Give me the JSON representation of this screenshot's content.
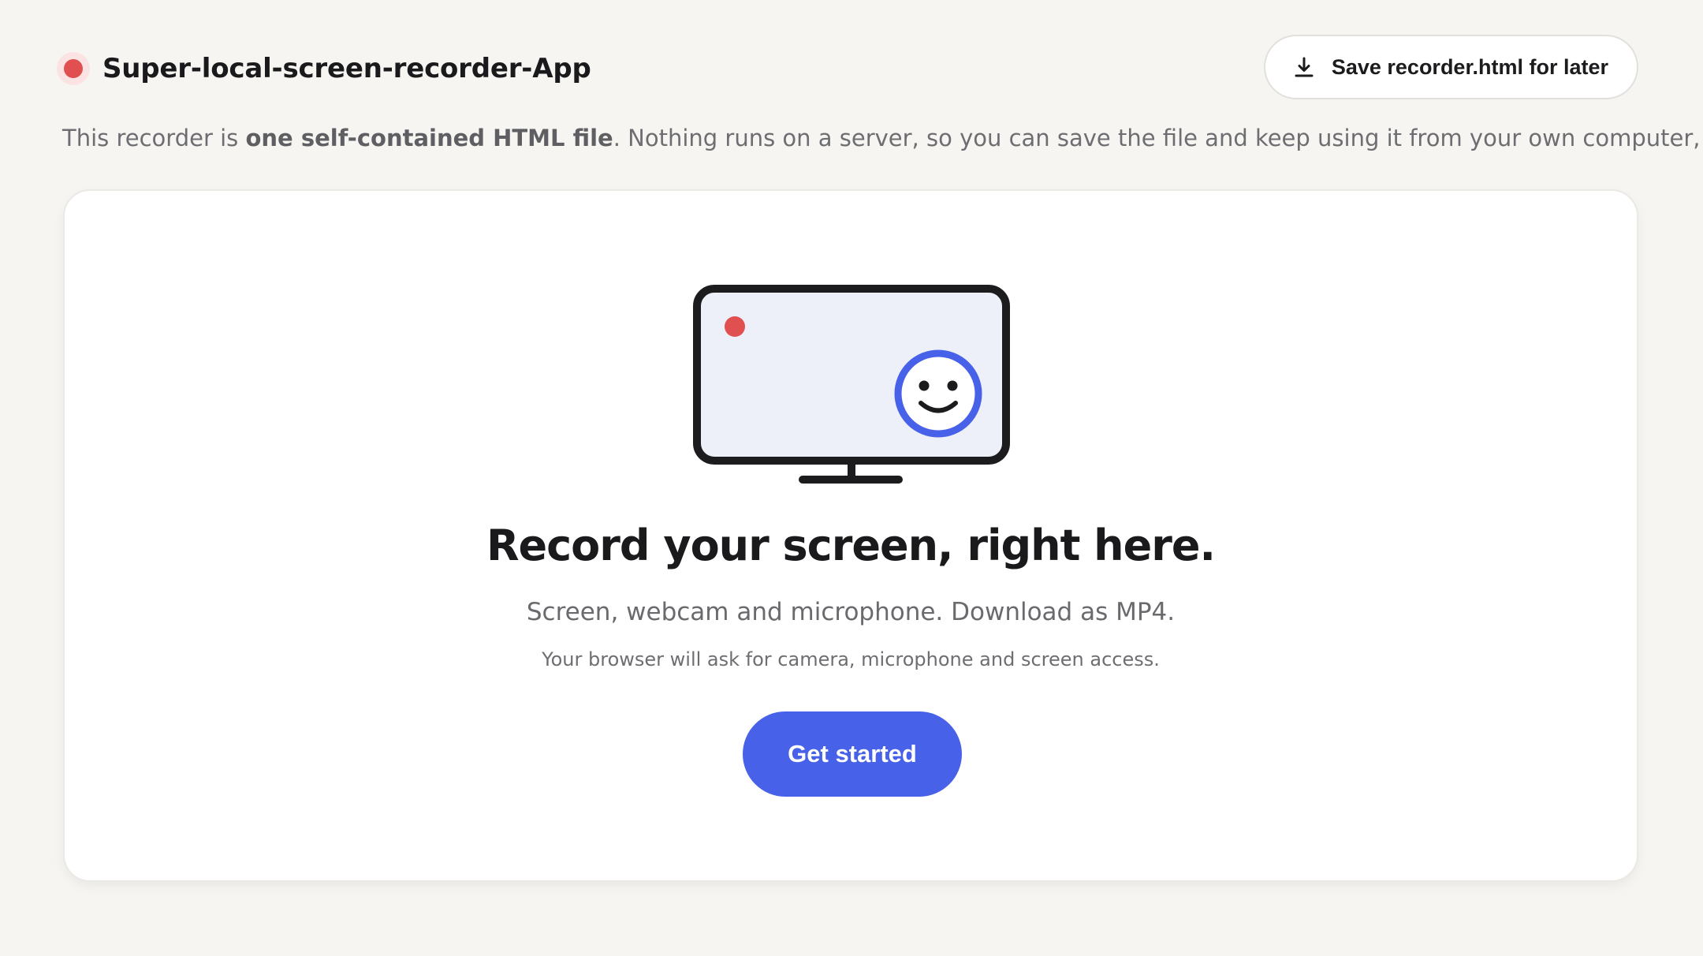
{
  "header": {
    "title": "Super-local-screen-recorder-App",
    "save_button_label": "Save recorder.html for later",
    "save_icon": "download-icon",
    "record_indicator_color": "#e05050"
  },
  "intro": {
    "prefix": "This recorder is ",
    "emphasis": "one self-contained HTML file",
    "suffix": ". Nothing runs on a server, so you can save the file and keep using it from your own computer, offline."
  },
  "hero": {
    "illustration_icon": "monitor-recording-icon",
    "headline": "Record your screen, right here.",
    "subtitle": "Screen, webcam and microphone. Download as MP4.",
    "note": "Your browser will ask for camera, microphone and screen access.",
    "cta_label": "Get started"
  },
  "colors": {
    "accent": "#4761e8",
    "record_red": "#e05050",
    "page_background": "#f6f5f2",
    "card_background": "#ffffff"
  }
}
